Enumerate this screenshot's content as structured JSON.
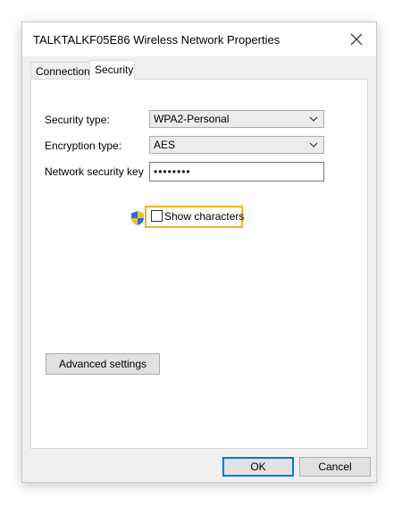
{
  "window": {
    "title": "TALKTALKF05E86 Wireless Network Properties"
  },
  "tabs": [
    {
      "label": "Connection"
    },
    {
      "label": "Security"
    }
  ],
  "security": {
    "security_type_label": "Security type:",
    "security_type_value": "WPA2-Personal",
    "encryption_type_label": "Encryption type:",
    "encryption_type_value": "AES",
    "network_key_label": "Network security key",
    "network_key_value": "••••••••",
    "show_characters_label": "Show characters",
    "advanced_settings_label": "Advanced settings"
  },
  "footer": {
    "ok_label": "OK",
    "cancel_label": "Cancel"
  },
  "colors": {
    "highlight": "#f5b21e",
    "default_button_border": "#0078d7"
  },
  "icons": {
    "close": "close-icon",
    "dropdown": "chevron-down-icon",
    "uac": "uac-shield-icon"
  }
}
